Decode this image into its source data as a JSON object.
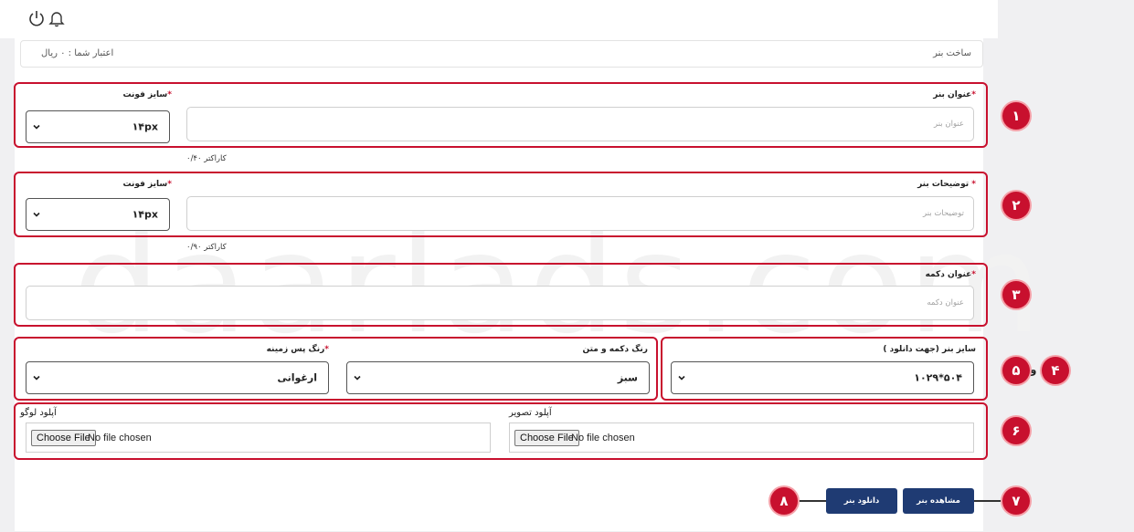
{
  "header": {
    "icons": [
      "power-icon",
      "bell-icon"
    ]
  },
  "breadcrumb": {
    "title": "ساخت بنر",
    "credit": "اعتبار شما : ۰ ریال"
  },
  "watermark": "daarlads.com",
  "banner_title": {
    "label": "عنوان بنر",
    "placeholder": "عنوان بنر",
    "counter": "کاراکتر ۰/۴۰"
  },
  "title_font": {
    "label": "سایز فونت",
    "value": "۱۴px"
  },
  "description": {
    "label": "توضیحات بنر",
    "placeholder": "توضیحات بنر",
    "counter": "کاراکتر ۰/۹۰"
  },
  "desc_font": {
    "label": "سایز فونت",
    "value": "۱۴px"
  },
  "button_title": {
    "label": "عنوان دکمه",
    "placeholder": "عنوان دکمه"
  },
  "banner_size": {
    "label": "سایز بنر (جهت دانلود )",
    "value": "۱۰۲۹*۵۰۴"
  },
  "button_color": {
    "label": "رنگ دکمه و متن",
    "value": "سبز"
  },
  "bg_color": {
    "label": "رنگ پس زمینه",
    "value": "ارغوانی"
  },
  "upload_image": {
    "label": "آپلود تصویر",
    "button": "Choose File",
    "status": "No file chosen"
  },
  "upload_logo": {
    "label": "آپلود لوگو",
    "button": "Choose File",
    "status": "No file chosen"
  },
  "actions": {
    "preview": "مشاهده بنر",
    "download": "دانلود بنر"
  },
  "annotations": {
    "b1": "۱",
    "b2": "۲",
    "b3": "۳",
    "b4": "۴",
    "and": "و",
    "b5": "۵",
    "b6": "۶",
    "b7": "۷",
    "b8": "۸"
  },
  "colors": {
    "accent": "#c8102e",
    "primary_button": "#1f3b73"
  }
}
